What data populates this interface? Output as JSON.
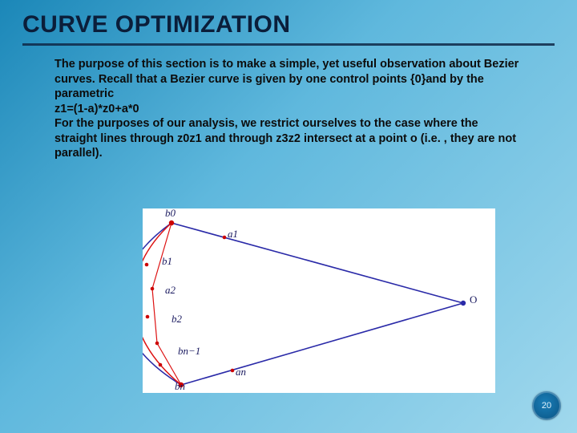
{
  "title": "CURVE OPTIMIZATION",
  "body": {
    "p1": "The purpose of this section is to make a simple, yet useful observation about Bezier curves. Recall that a Bezier curve is given by one control points {0}and by the parametric",
    "formula": "z1=(1-a)*z0+a*0",
    "p2": "For the purposes of our analysis, we restrict ourselves to the case where the straight lines through z0z1 and through z3z2 intersect at a point o (i.e. , they are not parallel)."
  },
  "diagram_labels": {
    "b0": "b0",
    "a1": "a1",
    "b1": "b1",
    "a2": "a2",
    "b2": "b2",
    "bn1": "bn−1",
    "an": "an",
    "bn": "bn",
    "O": "O"
  },
  "page_number": "20"
}
